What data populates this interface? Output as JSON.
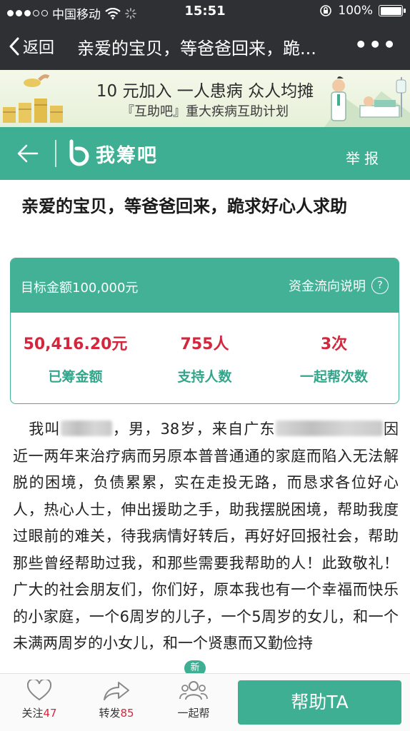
{
  "status_bar": {
    "carrier": "中国移动",
    "time": "15:51",
    "battery_percent": "100%",
    "battery_level": 1.0
  },
  "wechat_nav": {
    "back_label": "返回",
    "title": "亲爱的宝贝，等爸爸回来，跪...",
    "more_label": "•••"
  },
  "ad_banner": {
    "line1": "10 元加入  一人患病  众人均摊",
    "line2": "『互助吧』重大疾病互助计划"
  },
  "header": {
    "brand": "我筹吧",
    "report_label": "举报",
    "accent_color": "#3eaf93"
  },
  "article": {
    "title": "亲爱的宝贝，等爸爸回来，跪求好心人求助"
  },
  "stats_card": {
    "target_label": "目标金额100,000元",
    "fund_explain_label": "资金流向说明",
    "help_glyph": "?",
    "raised": {
      "value": "50,416.20元",
      "label": "已筹金额"
    },
    "supporters": {
      "value": "755人",
      "label": "支持人数"
    },
    "help_times": {
      "value": "3次",
      "label": "一起帮次数"
    }
  },
  "story": {
    "part1": "我叫",
    "part2": "，男，38岁，来自广东",
    "part3": "因近一两年来治疗病而另原本普普通通的家庭而陷入无法解脱的困境，负债累累，实在走投无路，而恳求各位好心人，热心人士，伸出援助之手，助我摆脱困境，帮助我度过眼前的难关，待我病情好转后，再好好回报社会，帮助那些曾经帮助过我，和那些需要我帮助的人！此致敬礼！    广大的社会朋友们，你们好，原本我也有一个幸福而快乐的小家庭，一个6周岁的儿子，一个5周岁的女儿，和一个未满两周岁的小女儿，和一个贤惠而又勤俭持"
  },
  "footer": {
    "follow_label": "关注",
    "follow_count": "47",
    "share_label": "转发",
    "share_count": "85",
    "together_label": "一起帮",
    "new_badge": "新",
    "help_button": "帮助TA"
  }
}
